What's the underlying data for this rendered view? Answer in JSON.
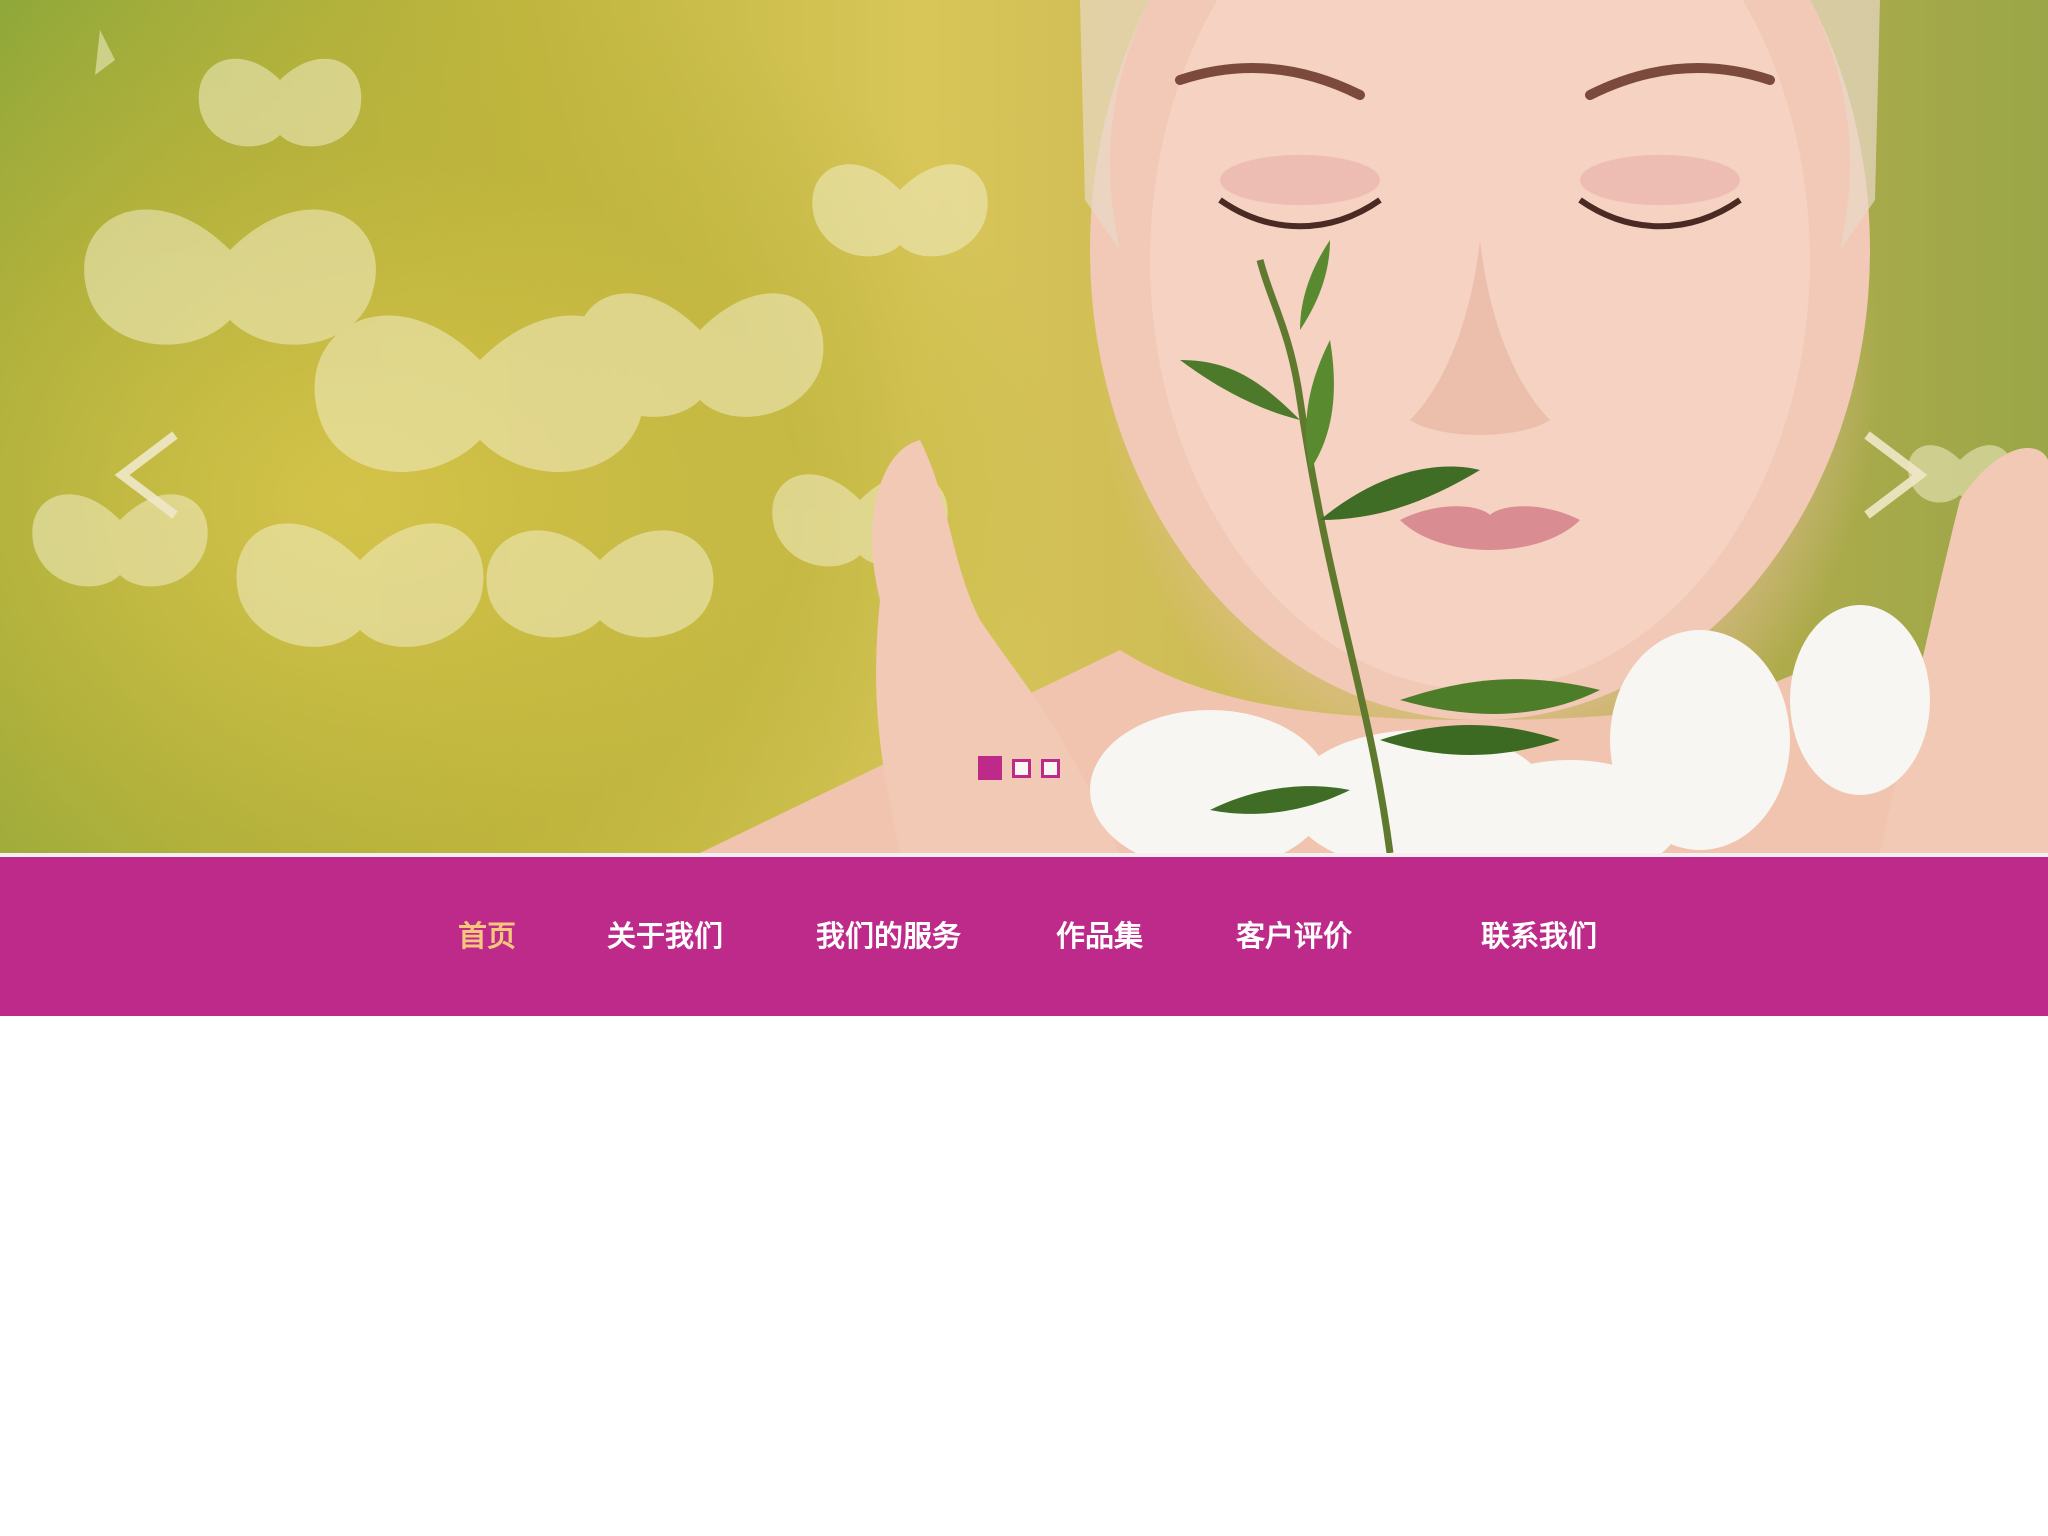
{
  "slider": {
    "prev_arrow": "<",
    "next_arrow": ">",
    "slide_count": 3,
    "active_slide": 1,
    "prev_icon": "chevron-left-icon",
    "next_icon": "chevron-right-icon"
  },
  "nav": {
    "items": [
      {
        "label": "首页",
        "active": true
      },
      {
        "label": "关于我们",
        "active": false
      },
      {
        "label": "我们的服务",
        "active": false
      },
      {
        "label": "作品集",
        "active": false
      },
      {
        "label": "客户评价",
        "active": false
      },
      {
        "label": "联系我们",
        "active": false
      }
    ]
  },
  "colors": {
    "brand": "#be2a89",
    "nav_active": "#f5c77e",
    "nav_text": "#ffffff",
    "page_bg": "#ffffff"
  }
}
